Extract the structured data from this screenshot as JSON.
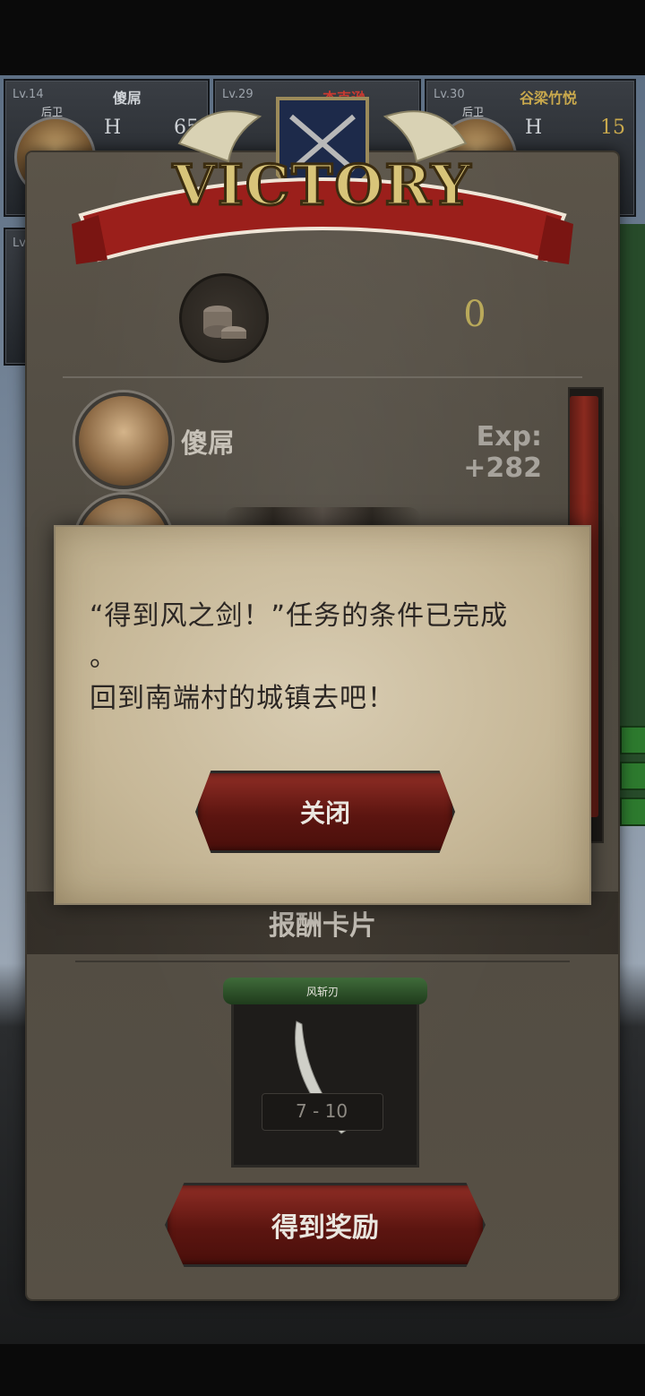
{
  "party_cards": [
    {
      "level": "Lv.14",
      "name": "傻屌",
      "role": "后卫",
      "hp_label": "H",
      "hp_value": "65"
    },
    {
      "level": "Lv.29",
      "name": "杰克逊",
      "role": "",
      "hp_label": "",
      "hp_value": ""
    },
    {
      "level": "Lv.30",
      "name": "谷梁竹悦",
      "role": "后卫",
      "hp_label": "H",
      "hp_value": "15"
    },
    {
      "level": "Lv.1"
    }
  ],
  "victory": {
    "banner_text": "VICTORY",
    "coin_value": "0",
    "member": {
      "name": "傻屌",
      "exp": "Exp: +282"
    },
    "reward_title": "报酬卡片",
    "reward_card": {
      "name": "风斩刃",
      "stat": "7 - 10"
    },
    "claim_button": "得到奖励"
  },
  "dialog": {
    "message_line1": "“得到风之剑！”任务的条件已完成",
    "message_line2": "。",
    "message_line3": "回到南端村的城镇去吧！",
    "close_button": "关闭"
  },
  "colors": {
    "accent_red": "#8f2d25",
    "gold": "#c9a94d",
    "parchment": "#c7b898"
  }
}
